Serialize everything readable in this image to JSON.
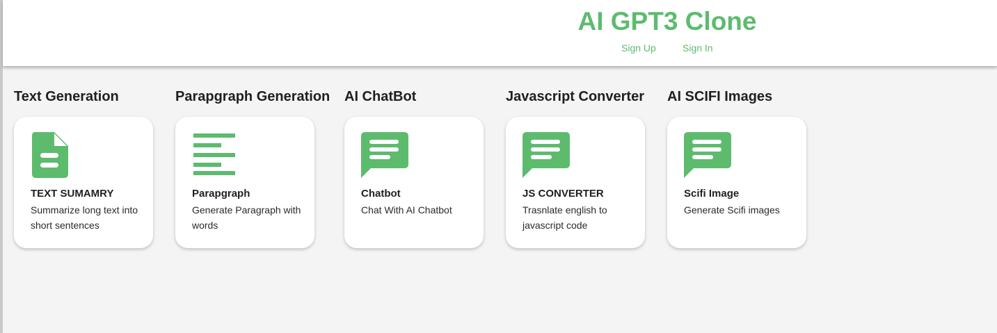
{
  "header": {
    "title": "AI GPT3 Clone",
    "sign_up": "Sign Up",
    "sign_in": "Sign In"
  },
  "theme": {
    "accent": "#5dbb6e"
  },
  "sections": [
    {
      "heading": "Text Generation",
      "card": {
        "icon": "document-icon",
        "title": "TEXT SUMAMRY",
        "description": "Summarize long text into short sentences"
      }
    },
    {
      "heading": "Parapgraph Generation",
      "card": {
        "icon": "paragraph-lines-icon",
        "title": "Parapgraph",
        "description": "Generate Paragraph with words"
      }
    },
    {
      "heading": "AI ChatBot",
      "card": {
        "icon": "chat-message-icon",
        "title": "Chatbot",
        "description": "Chat With AI Chatbot"
      }
    },
    {
      "heading": "Javascript Converter",
      "card": {
        "icon": "chat-message-icon",
        "title": "JS CONVERTER",
        "description": "Trasnlate english to javascript code"
      }
    },
    {
      "heading": "AI SCIFI Images",
      "card": {
        "icon": "chat-message-icon",
        "title": "Scifi Image",
        "description": "Generate Scifi images"
      }
    }
  ]
}
